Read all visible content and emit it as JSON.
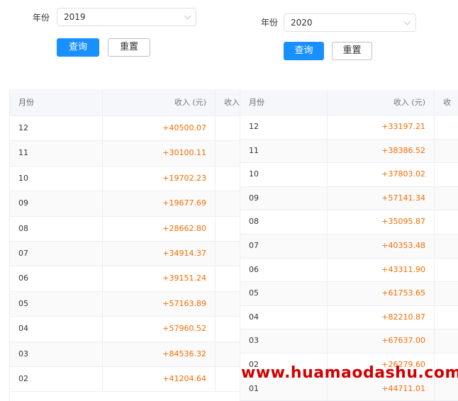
{
  "left": {
    "year_label": "年份",
    "year_value": "2019",
    "query_label": "查询",
    "reset_label": "重置",
    "header": {
      "month": "月份",
      "income": "收入 (元)",
      "extra": "收入"
    },
    "rows": [
      {
        "month": "12",
        "income": "+40500.07"
      },
      {
        "month": "11",
        "income": "+30100.11"
      },
      {
        "month": "10",
        "income": "+19702.23"
      },
      {
        "month": "09",
        "income": "+19677.69"
      },
      {
        "month": "08",
        "income": "+28662.80"
      },
      {
        "month": "07",
        "income": "+34914.37"
      },
      {
        "month": "06",
        "income": "+39151.24"
      },
      {
        "month": "05",
        "income": "+57163.89"
      },
      {
        "month": "04",
        "income": "+57960.52"
      },
      {
        "month": "03",
        "income": "+84536.32"
      },
      {
        "month": "02",
        "income": "+41204.64"
      }
    ]
  },
  "right": {
    "year_label": "年份",
    "year_value": "2020",
    "query_label": "查询",
    "reset_label": "重置",
    "header": {
      "month": "月份",
      "income": "收入 (元)",
      "extra": "收"
    },
    "rows": [
      {
        "month": "12",
        "income": "+33197.21"
      },
      {
        "month": "11",
        "income": "+38386.52"
      },
      {
        "month": "10",
        "income": "+37803.02"
      },
      {
        "month": "09",
        "income": "+57141.34"
      },
      {
        "month": "08",
        "income": "+35095.87"
      },
      {
        "month": "07",
        "income": "+40353.48"
      },
      {
        "month": "06",
        "income": "+43311.90"
      },
      {
        "month": "05",
        "income": "+61753.65"
      },
      {
        "month": "04",
        "income": "+82210.87"
      },
      {
        "month": "03",
        "income": "+67637.00"
      },
      {
        "month": "02",
        "income": "+26279.60"
      },
      {
        "month": "01",
        "income": "+44711.01"
      }
    ]
  },
  "watermark": "www.huamaodashu.com",
  "colors": {
    "primary": "#1890ff",
    "income": "#f56c00",
    "watermark": "#d10000"
  }
}
